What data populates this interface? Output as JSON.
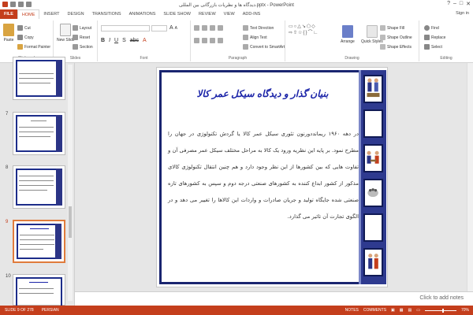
{
  "titlebar": {
    "title": "دیدگاه ها و نظریات بازرگانی بین المللی.pptx - PowerPoint",
    "signin": "Sign in"
  },
  "tabs": [
    "FILE",
    "HOME",
    "INSERT",
    "DESIGN",
    "TRANSITIONS",
    "ANIMATIONS",
    "SLIDE SHOW",
    "REVIEW",
    "VIEW",
    "ADD-INS"
  ],
  "ribbon": {
    "clipboard": {
      "paste": "Paste",
      "cut": "Cut",
      "copy": "Copy",
      "painter": "Format Painter",
      "label": "Clipboard"
    },
    "slides": {
      "new_slide": "New Slide",
      "layout": "Layout",
      "reset": "Reset",
      "section": "Section",
      "label": "Slides"
    },
    "font": {
      "label": "Font"
    },
    "paragraph": {
      "text_direction": "Text Direction",
      "align_text": "Align Text",
      "smartart": "Convert to SmartArt",
      "label": "Paragraph"
    },
    "drawing": {
      "arrange": "Arrange",
      "quick_styles": "Quick Styles",
      "shape_fill": "Shape Fill",
      "shape_outline": "Shape Outline",
      "shape_effects": "Shape Effects",
      "label": "Drawing"
    },
    "editing": {
      "find": "Find",
      "replace": "Replace",
      "select": "Select",
      "label": "Editing"
    }
  },
  "slides_pane": {
    "numbers": [
      "7",
      "8",
      "9",
      "10"
    ],
    "current": "9"
  },
  "slide": {
    "title": "بنیان گذار و دیدگاه سیکل عمر کالا",
    "body": "در دهه ۱۹۶۰ ریمانددورنون تئوری سیکل عمر کالا یا گردش تکنولوژی در جهان را مطرح نمود. بر پایه این نظریه ورود یک کالا به مراحل مختلف سیکل عمر مصرفی آن و تفاوت هایی که بین کشورها از این نظر وجود دارد و هم چنین انتقال تکنولوژی کالای مذکور از کشور ابداع کننده به کشورهای صنعتی درجه دوم و سپس به کشورهای تازه صنعتی شده جایگاه تولید و جریان صادرات و واردات این کالاها را تغییر می دهد و در الگوی تجارت آن تاثیر می گذارد."
  },
  "notes": {
    "placeholder": "Click to add notes"
  },
  "status": {
    "slide": "SLIDE 9 OF 278",
    "lang": "PERSIAN",
    "notes": "NOTES",
    "comments": "COMMENTS",
    "zoom": "70%"
  },
  "colors": {
    "accent": "#c43e1c",
    "title": "#1a23a8",
    "frame": "#1a2570"
  }
}
